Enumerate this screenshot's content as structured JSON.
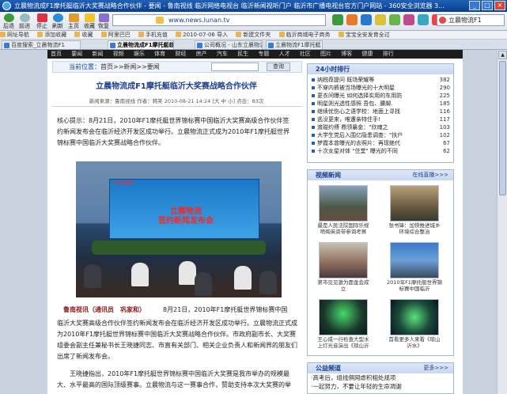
{
  "window": {
    "title": "立晨物流成F1摩托艇临沂大奖赛战略合作伙伴 - 要闻 - 鲁南视线 临沂网络电视台 临沂新闻视听门户 临沂市广播电视台官方门户网站 - 360安全浏览器 3...",
    "controls": [
      "_",
      "□",
      "×"
    ]
  },
  "toolbar": {
    "back": "后退",
    "forward": "前进",
    "refresh": "刷新",
    "stop": "停止",
    "home": "主页",
    "favorites": "收藏",
    "restore": "恢复",
    "address": "www.news.lunan.tv",
    "search_label": "立晨物流F1"
  },
  "favorites_bar": [
    "网址导航",
    "添加收藏",
    "收藏",
    "阿里巴巴",
    "手机充值",
    "2010-07-06 导入",
    "新建文件夹",
    "临沂商城电子商务",
    "宝宝全安发育全过"
  ],
  "tabs": [
    {
      "label": "百度搜索_立晨物流F1"
    },
    {
      "label": "立晨物流成F1摩托艇临沂大"
    },
    {
      "label": "公司概况 - 山东立晨物流股"
    },
    {
      "label": "立晨物流F1摩托艇"
    }
  ],
  "site_nav": [
    "首页",
    "要闻",
    "新闻",
    "视频",
    "娱乐",
    "体育",
    "财经",
    "房产",
    "汽车",
    "民生",
    "专题",
    "人才",
    "社区",
    "图片",
    "博客",
    "健康",
    "排行"
  ],
  "breadcrumb": {
    "label": "当前位置：",
    "path": "首页>>新闻>>要闻",
    "search_button": "查询"
  },
  "article": {
    "title": "立晨物流成F1摩托艇临沂大奖赛战略合作伙伴",
    "meta": "新闻来源：鲁南视线   作者：韩笑   2010-08-21 14:24  [大 中 小]  点击：83次",
    "summary": "核心提示：8月21日，2010年F1摩托艇世界锦标赛中国临沂大奖赛高级合作伙伴签约新闻发布会在临沂经济开发区成功举行。立晨物流正式成为2010年F1摩托艇世界锦标赛中国临沂大奖赛战略合作伙伴。",
    "photo_caption_title": "立晨物流\n签约新闻发布会",
    "photo_logo": "LICHEN",
    "reporter": "鲁南视讯（通讯员　巩家和）",
    "date": "8月21日，2010年F1摩托艇世界锦标赛中国",
    "paragraph1": "临沂大奖赛高级合作伙伴签约新闻发布会在临沂经济开发区成功举行。立晨物流正式成为2010年F1摩托艇世界锦标赛中国临沂大奖赛战略合作伙伴。市政府副市长、大奖赛组委会副主任兼秘书长王晓捷同志、市直有关部门、相关企业负责人和新闻界的朋友们出席了新闻发布会。",
    "paragraph2": "王晓捷指出，2010年F1摩托艇世界锦标赛中国临沂大奖赛是我市举办的规模最大、水平最高的国际顶级赛事。立晨物流与这一赛事合作，赞助支持本次大奖赛的举"
  },
  "ranking": {
    "title": "24小时排行",
    "items": [
      {
        "text": "纳税荐提问 既场荣耀等",
        "count": "382"
      },
      {
        "text": "不穿内裤被当场曝光的十大明星",
        "count": "290"
      },
      {
        "text": "更衣间曝光 如何选择实用的车用防",
        "count": "225"
      },
      {
        "text": "明星则光透性感照 吾包、腰脚.",
        "count": "185"
      },
      {
        "text": "继续忧伤心之语学校：地面上寻找",
        "count": "116"
      },
      {
        "text": "逃没更来，唯遭亲特住手!",
        "count": "117"
      },
      {
        "text": "渡碰约傅 鼎领暴金：\"欣魂之",
        "count": "103"
      },
      {
        "text": "大学生党后入围亿隐患调查：\"扶户",
        "count": "102"
      },
      {
        "text": "梦霞本曾曝光的去照片：再现绝代",
        "count": "67"
      },
      {
        "text": "十次女星对体 \"住堂\" 曝光的不同",
        "count": "62"
      }
    ]
  },
  "video": {
    "title": "视频新闻",
    "more": "在线直播>>>",
    "items": [
      {
        "caption": "最是人民法院国际乐规 喷绚英资带参询考察"
      },
      {
        "caption": "张书锋：加快推进城乡环境综合整治"
      },
      {
        "caption": "第市见见激为面金会成立"
      },
      {
        "caption": "2010年F1摩托艇世界锦 标赛中国临沂"
      },
      {
        "caption": "王心成一行检查大型水 上灯光音演出《琅山沂水》"
      },
      {
        "caption": "首看更多人来看《琅山沂水》"
      }
    ]
  },
  "public_service": {
    "title": "公益频道",
    "more": "更多>>>",
    "items": [
      "·高考后，组线俱网虐积相处规项",
      "·一起努力，不要让年轻的生命凋谢"
    ]
  }
}
